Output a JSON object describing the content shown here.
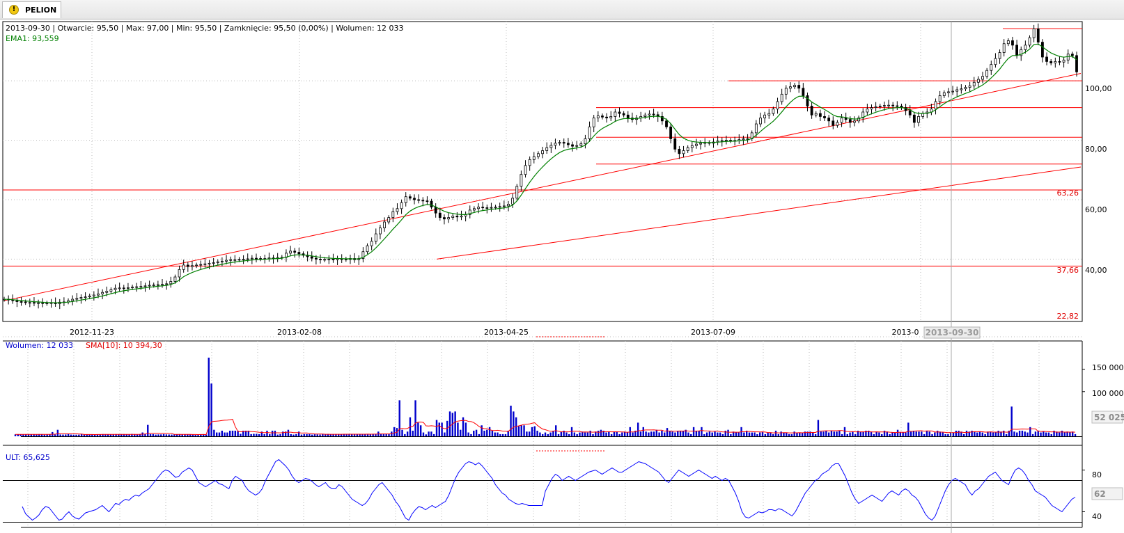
{
  "tab": {
    "title": "PELION",
    "icon": "warning-icon"
  },
  "colors": {
    "candle": "#000000",
    "ema": "#008000",
    "lines": "#ff0000",
    "volume": "#0000cc",
    "sma": "#ff0000",
    "ult": "#0000ff",
    "grid": "#c8c8c8"
  },
  "main": {
    "info_bar": "2013-09-30 | Otwarcie: 95,50 | Max: 97,00 | Min: 95,50 | Zamknięcie: 95,50 (0,00%)  | Wolumen: 12 033",
    "ema_label": "EMA1: 93,559",
    "y_ticks": [
      "100,00",
      "80,00",
      "60,00",
      "40,00"
    ],
    "level_labels": [
      "63,26",
      "37,66",
      "22,82"
    ],
    "x_ticks": [
      "2012-11-23",
      "2013-02-08",
      "2013-04-25",
      "2013-07-09",
      "2013-0"
    ],
    "cursor_date": "2013-09-30"
  },
  "volume": {
    "label_vol": "Wolumen: 12 033",
    "label_sma": "SMA[10]: 10 394,30",
    "y_ticks": [
      "150 000",
      "100 000"
    ],
    "cursor_value": "52 025"
  },
  "ult": {
    "label": "ULT: 65,625",
    "y_ticks": [
      "80",
      "40"
    ],
    "cursor_value": "62"
  },
  "chart_data": [
    {
      "type": "candlestick",
      "x_start": "2012-10-01",
      "x_end": "2014-01-07",
      "x_ticks": [
        "2012-11-23",
        "2013-02-08",
        "2013-04-25",
        "2013-07-09"
      ],
      "ylim": [
        23,
        119
      ],
      "y_ticks": [
        40,
        60,
        80,
        100
      ],
      "close_series": [
        26.5,
        26.3,
        26.0,
        25.7,
        25.6,
        25.4,
        25.4,
        25.2,
        25.3,
        25.1,
        25.2,
        25.3,
        25.0,
        25.5,
        25.6,
        26.0,
        26.5,
        26.8,
        27.1,
        27.3,
        27.6,
        27.9,
        28.3,
        28.8,
        29.2,
        29.7,
        30.2,
        30.3,
        30.2,
        30.4,
        30.6,
        30.7,
        30.8,
        31.0,
        31.2,
        31.3,
        31.4,
        31.5,
        31.7,
        32.5,
        34.0,
        36.5,
        38.0,
        37.5,
        37.8,
        38.0,
        38.2,
        38.4,
        38.6,
        38.8,
        39.1,
        39.3,
        39.6,
        39.8,
        39.8,
        39.9,
        40.0,
        40.1,
        40.3,
        40.2,
        40.1,
        40.2,
        40.4,
        40.3,
        40.5,
        40.6,
        42.0,
        42.7,
        42.3,
        41.8,
        41.3,
        40.8,
        40.3,
        40.0,
        39.8,
        39.9,
        40.0,
        39.8,
        40.1,
        40.0,
        39.9,
        40.2,
        39.8,
        40.2,
        42.5,
        44.5,
        46.0,
        48.5,
        50.5,
        52.5,
        54.0,
        56.0,
        57.0,
        59.0,
        61.0,
        60.5,
        60.0,
        59.8,
        59.6,
        59.5,
        57.5,
        55.5,
        54.0,
        53.5,
        54.0,
        54.5,
        54.2,
        54.5,
        55.0,
        56.5,
        57.0,
        57.5,
        57.3,
        57.2,
        57.4,
        57.5,
        57.7,
        57.9,
        58.5,
        60.5,
        64.5,
        68.5,
        71.5,
        73.5,
        74.5,
        75.5,
        76.5,
        77.5,
        78.3,
        79.0,
        79.3,
        79.0,
        78.5,
        78.0,
        78.2,
        78.8,
        80.5,
        84.5,
        87.5,
        88.2,
        87.8,
        87.5,
        88.0,
        89.5,
        89.0,
        88.5,
        87.5,
        87.0,
        87.5,
        88.0,
        88.5,
        88.8,
        88.6,
        88.0,
        86.5,
        84.5,
        80.5,
        77.0,
        75.5,
        76.5,
        77.5,
        78.2,
        78.7,
        79.0,
        79.2,
        79.0,
        79.4,
        79.7,
        79.9,
        80.0,
        79.9,
        79.8,
        80.2,
        80.5,
        80.5,
        82.5,
        85.5,
        87.5,
        88.5,
        89.0,
        90.5,
        93.0,
        95.5,
        97.5,
        98.0,
        98.5,
        97.5,
        95.0,
        91.5,
        88.5,
        89.0,
        88.0,
        87.5,
        86.5,
        85.0,
        86.0,
        87.5,
        87.0,
        86.0,
        86.5,
        87.5,
        89.5,
        90.5,
        91.0,
        91.3,
        91.5,
        91.7,
        91.8,
        91.6,
        91.5,
        91.0,
        90.0,
        88.5,
        86.0,
        88.0,
        89.0,
        89.5,
        90.5,
        93.0,
        95.0,
        96.0,
        96.3,
        96.5,
        97.0,
        97.3,
        97.8,
        98.3,
        99.5,
        100.5,
        101.5,
        103.5,
        105.5,
        107.5,
        109.5,
        112.5,
        113.5,
        112.0,
        108.5,
        110.5,
        112.0,
        114.5,
        117.5,
        113.0,
        108.0,
        106.5,
        106.0,
        106.5,
        106.3,
        107.0,
        109.0,
        108.5,
        103.0
      ],
      "ema_label": "EMA1: 93,559",
      "levels": [
        117.5,
        100.0,
        91.0,
        81.0,
        72.0,
        63.26,
        37.66,
        22.82
      ],
      "trendlines": [
        {
          "from": [
            "2012-10-01",
            26.0
          ],
          "to": [
            "2014-01-07",
            102.5
          ]
        },
        {
          "from": [
            "2013-04-05",
            40.0
          ],
          "to": [
            "2014-01-07",
            71.0
          ]
        }
      ]
    },
    {
      "type": "bar",
      "title": "Wolumen",
      "ylim": [
        0,
        190000
      ],
      "y_ticks": [
        100000,
        150000
      ],
      "volume_series": [
        4200,
        4200,
        4500,
        3800,
        4200,
        4200,
        4200,
        4600,
        3800,
        4800,
        4800,
        3600,
        3800,
        4200,
        9500,
        3800,
        14500,
        4000,
        3800,
        4000,
        4800,
        3800,
        3600,
        3600,
        3600,
        4800,
        3800,
        4200,
        3800,
        4200,
        4200,
        4600,
        4200,
        4800,
        4200,
        4200,
        3800,
        3800,
        4800,
        4200,
        4800,
        4800,
        4200,
        3800,
        5200,
        4800,
        3800,
        4800,
        8500,
        4800,
        25500,
        4800,
        4800,
        3800,
        4200,
        4200,
        4800,
        4200,
        4000,
        3800,
        4000,
        4500,
        4800,
        3800,
        4600,
        4000,
        3800,
        3600,
        3200,
        3000,
        4500,
        4800,
        3800,
        176000,
        118000,
        14500,
        8500,
        8500,
        12500,
        8500,
        8500,
        12500,
        12500,
        12500,
        12500,
        5500,
        12500,
        12500,
        12500,
        4800,
        5500,
        5500,
        4800,
        10500,
        4800,
        12500,
        4800,
        12500,
        12500,
        3800,
        4800,
        10500,
        10500,
        14500,
        4800,
        3800,
        4800,
        10500,
        3800,
        4800,
        4800,
        4800,
        3800,
        4500,
        4200,
        3800,
        5200,
        4800,
        5200,
        4200,
        4200,
        4800,
        4800,
        4500,
        4800,
        4200,
        4800,
        4800,
        5200,
        4800,
        4800,
        4800,
        4800,
        4800,
        4200,
        4800,
        4800,
        10500,
        4800,
        4800,
        4800,
        4800,
        10500,
        20500,
        18500,
        80500,
        14500,
        4800,
        10500,
        42500,
        12500,
        80500,
        30500,
        24500,
        8500,
        4200,
        10500,
        10500,
        4800,
        36500,
        30500,
        30500,
        8500,
        34500,
        55500,
        52500,
        55500,
        30500,
        14500,
        42500,
        30500,
        8500,
        4800,
        12500,
        14500,
        4800,
        24500,
        12500,
        14500,
        20500,
        12500,
        8500,
        8500,
        4800,
        4800,
        4800,
        12500,
        68500,
        55500,
        42500,
        22500,
        24500,
        24500,
        10500,
        10500,
        20500,
        22500,
        12500,
        8500,
        4800,
        8500,
        4800,
        8500,
        12500,
        24500,
        4800,
        10500,
        12500,
        8500,
        4800,
        20500,
        8500,
        4800,
        8500,
        10500,
        8500,
        8500,
        12500,
        4800,
        10500,
        12500,
        14500,
        12500,
        8500,
        10500,
        4800,
        10500,
        10500,
        4800,
        8500,
        10500,
        8500,
        20500,
        8500,
        12500,
        30500,
        10500,
        20500,
        10500,
        8500,
        10500,
        10500,
        14500,
        8500,
        12500,
        8500,
        18500,
        12500,
        10500,
        8500,
        12500,
        12500,
        12500,
        14500,
        8500,
        4800,
        20500,
        12500,
        12500,
        20500,
        4800,
        8500,
        10500,
        8500,
        10500,
        8500,
        8500,
        4800,
        12500,
        14500,
        4800,
        10500,
        8500,
        8500,
        20500,
        8500,
        12500,
        8500,
        8500,
        8500,
        4800,
        8500,
        10500,
        4800,
        8500,
        8500,
        4800,
        12500,
        4800,
        10500,
        8500,
        8500,
        4800,
        4800,
        10500,
        8500,
        8500,
        8500,
        10500,
        10500,
        10500,
        8500,
        4800,
        36500,
        10500,
        10500,
        12500,
        8500,
        12500,
        10500,
        10500,
        12500,
        4800,
        20500,
        4800,
        8500,
        10500,
        4800,
        12500,
        10500,
        10500,
        12500,
        12500,
        10500,
        4800,
        10500,
        8500,
        4800,
        12500,
        10500,
        4800,
        8500,
        8500,
        14500,
        8500,
        8500,
        8500,
        30500,
        10500,
        12500,
        10500,
        10500,
        10500,
        4800,
        12500,
        10500,
        4800,
        8500,
        12500,
        10500,
        8500,
        4800,
        4800,
        8500,
        8500,
        12500,
        12500,
        10500,
        4800,
        12500,
        10500,
        12500,
        10500,
        8500,
        10500,
        8500,
        4800,
        10500,
        10500,
        8500,
        8500,
        12500,
        10500,
        12500,
        4800,
        12500,
        66500,
        10500,
        8500,
        12500,
        12500,
        10500,
        8500,
        20500,
        4800,
        10500,
        12500,
        8500,
        10500,
        8500,
        8500,
        4800,
        12500,
        10500,
        8500,
        12500,
        8500,
        10500,
        8500,
        10500,
        4800
      ],
      "sma_label": "SMA[10]: 10 394,30",
      "cursor_value": 52025
    },
    {
      "type": "line",
      "title": "ULT",
      "ylim": [
        25,
        95
      ],
      "y_ticks": [
        40,
        80
      ],
      "ult_series": [
        45,
        38,
        35,
        32,
        34,
        37,
        42,
        45,
        44,
        40,
        36,
        32,
        33,
        37,
        40,
        36,
        34,
        33,
        36,
        39,
        40,
        41,
        42,
        44,
        46,
        43,
        40,
        44,
        48,
        47,
        50,
        52,
        51,
        54,
        56,
        55,
        58,
        60,
        62,
        66,
        70,
        74,
        78,
        80,
        79,
        76,
        73,
        74,
        78,
        80,
        82,
        80,
        74,
        68,
        66,
        64,
        66,
        68,
        70,
        67,
        66,
        64,
        62,
        70,
        74,
        72,
        70,
        64,
        60,
        58,
        56,
        58,
        62,
        70,
        76,
        82,
        88,
        90,
        87,
        84,
        80,
        74,
        70,
        68,
        70,
        72,
        71,
        69,
        66,
        64,
        66,
        68,
        64,
        62,
        62,
        66,
        64,
        60,
        56,
        52,
        50,
        48,
        46,
        48,
        52,
        58,
        62,
        66,
        68,
        64,
        60,
        56,
        50,
        46,
        40,
        34,
        32,
        38,
        42,
        45,
        44,
        42,
        44,
        46,
        44,
        46,
        48,
        50,
        56,
        64,
        72,
        78,
        82,
        86,
        88,
        87,
        85,
        87,
        84,
        80,
        76,
        72,
        66,
        62,
        58,
        56,
        52,
        50,
        48,
        47,
        48,
        47,
        46,
        46,
        46,
        46,
        46,
        60,
        66,
        72,
        76,
        74,
        70,
        72,
        74,
        72,
        70,
        72,
        74,
        76,
        78,
        79,
        80,
        78,
        76,
        78,
        80,
        82,
        80,
        78,
        78,
        80,
        82,
        84,
        86,
        88,
        87,
        86,
        84,
        82,
        80,
        78,
        74,
        70,
        68,
        72,
        76,
        80,
        78,
        76,
        74,
        76,
        78,
        80,
        78,
        76,
        74,
        72,
        74,
        72,
        70,
        72,
        70,
        64,
        58,
        50,
        40,
        35,
        34,
        36,
        38,
        40,
        39,
        40,
        42,
        42,
        41,
        43,
        42,
        40,
        38,
        36,
        40,
        46,
        52,
        58,
        62,
        66,
        70,
        72,
        76,
        78,
        80,
        84,
        86,
        86,
        80,
        74,
        66,
        58,
        52,
        48,
        50,
        52,
        54,
        56,
        54,
        52,
        50,
        54,
        58,
        60,
        58,
        56,
        60,
        62,
        60,
        56,
        54,
        50,
        44,
        38,
        34,
        32,
        36,
        44,
        52,
        60,
        66,
        70,
        72,
        70,
        68,
        66,
        60,
        56,
        60,
        62,
        66,
        70,
        74,
        76,
        78,
        74,
        70,
        68,
        66,
        74,
        80,
        82,
        80,
        76,
        70,
        66,
        60,
        58,
        56,
        54,
        50,
        46,
        44,
        42,
        40,
        44,
        48,
        52,
        54
      ],
      "ult_label": "ULT: 65,625",
      "cursor_value": 62
    }
  ]
}
